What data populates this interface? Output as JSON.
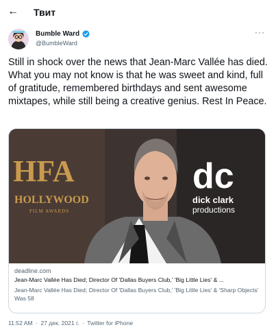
{
  "header": {
    "back_icon": "arrow-left-icon",
    "title": "Твит"
  },
  "tweet": {
    "author_name": "Bumble Ward",
    "verified": true,
    "handle": "@BumbleWard",
    "more_icon": "more-horizontal-icon",
    "text": "Still in shock over the news that Jean-Marc Vallée has died. What you may not know is that he was sweet and kind, full of gratitude, remembered birthdays and sent awesome mixtapes, while still being a creative genius. Rest In Peace."
  },
  "card": {
    "image_backdrop": {
      "hfa": "HFA",
      "hollywood": "HOLLYWOOD",
      "film_awards": "FILM AWARDS",
      "dc": "dc",
      "dick_clark": "dick clark",
      "productions": "productions"
    },
    "domain": "deadline.com",
    "title": "Jean-Marc Vallée Has Died; Director Of 'Dallas Buyers Club,' 'Big Little Lies' & ...",
    "description": "Jean-Marc Vallée Has Died; Director Of 'Dallas Buyers Club,' 'Big Little Lies' & 'Sharp Objects' Was 58"
  },
  "meta": {
    "time": "11:52 AM",
    "date": "27 дек. 2021 г.",
    "separator": "·",
    "source": "Twitter for iPhone"
  },
  "colors": {
    "accent": "#1d9bf0",
    "text": "#0f1419",
    "secondary": "#536471",
    "border": "#cfd9de"
  }
}
